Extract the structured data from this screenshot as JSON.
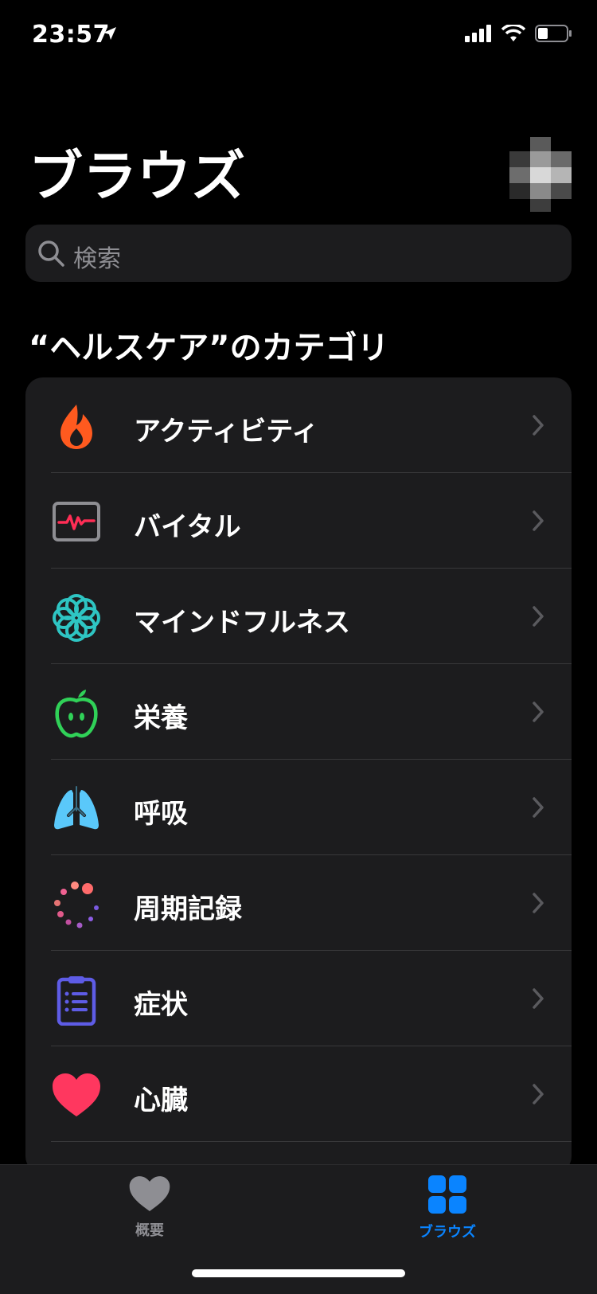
{
  "status_bar": {
    "time": "23:57"
  },
  "header": {
    "title": "ブラウズ"
  },
  "search": {
    "placeholder": "検索"
  },
  "section": {
    "title": "“ヘルスケア”のカテゴリ"
  },
  "categories": [
    {
      "label": "アクティビティ",
      "icon": "flame-icon",
      "color": "#ff5a1f"
    },
    {
      "label": "バイタル",
      "icon": "vitals-monitor-icon",
      "color": "#ff2d55"
    },
    {
      "label": "マインドフルネス",
      "icon": "mindfulness-flower-icon",
      "color": "#2ec5c3"
    },
    {
      "label": "栄養",
      "icon": "apple-icon",
      "color": "#30d158"
    },
    {
      "label": "呼吸",
      "icon": "lungs-icon",
      "color": "#5ac8fa"
    },
    {
      "label": "周期記録",
      "icon": "cycle-dots-icon",
      "color": "#ff6b6b"
    },
    {
      "label": "症状",
      "icon": "clipboard-icon",
      "color": "#5e5ce6"
    },
    {
      "label": "心臓",
      "icon": "heart-icon",
      "color": "#ff375f"
    }
  ],
  "tabbar": {
    "summary_label": "概要",
    "browse_label": "ブラウズ",
    "active_color": "#0a84ff",
    "inactive_color": "#8e8e93"
  }
}
